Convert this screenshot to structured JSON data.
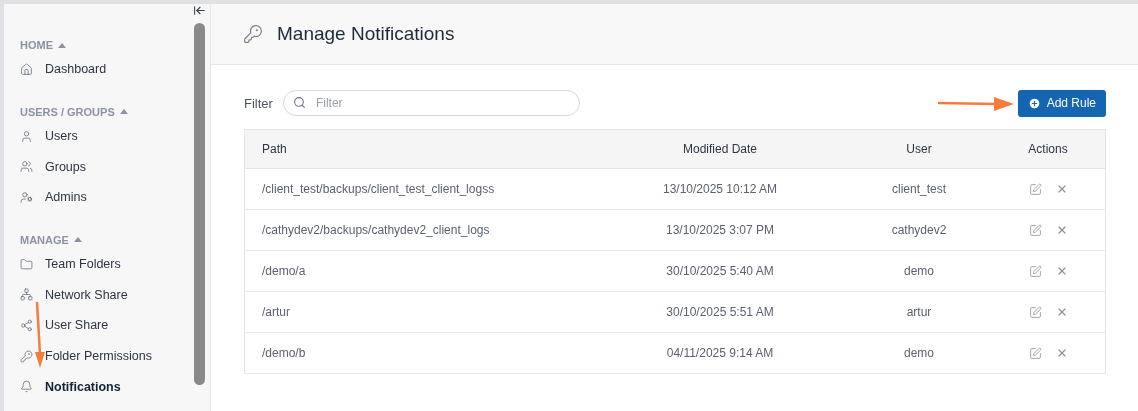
{
  "sidebar": {
    "sections": [
      {
        "title": "HOME",
        "expanded": true,
        "items": [
          {
            "label": "Dashboard",
            "selected": false
          }
        ]
      },
      {
        "title": "USERS / GROUPS",
        "expanded": true,
        "items": [
          {
            "label": "Users",
            "selected": false
          },
          {
            "label": "Groups",
            "selected": false
          },
          {
            "label": "Admins",
            "selected": false
          }
        ]
      },
      {
        "title": "MANAGE",
        "expanded": true,
        "items": [
          {
            "label": "Team Folders",
            "selected": false
          },
          {
            "label": "Network Share",
            "selected": false
          },
          {
            "label": "User Share",
            "selected": false
          },
          {
            "label": "Folder Permissions",
            "selected": false
          },
          {
            "label": "Notifications",
            "selected": true
          }
        ]
      }
    ]
  },
  "page": {
    "title": "Manage Notifications"
  },
  "filter": {
    "label": "Filter",
    "placeholder": "Filter"
  },
  "add_button": "Add Rule",
  "table": {
    "columns": [
      "Path",
      "Modified Date",
      "User",
      "Actions"
    ],
    "rows": [
      {
        "path": "/client_test/backups/client_test_client_logss",
        "modified": "13/10/2025 10:12 AM",
        "user": "client_test"
      },
      {
        "path": "/cathydev2/backups/cathydev2_client_logs",
        "modified": "13/10/2025 3:07 PM",
        "user": "cathydev2"
      },
      {
        "path": "/demo/a",
        "modified": "30/10/2025 5:40 AM",
        "user": "demo"
      },
      {
        "path": "/artur",
        "modified": "30/10/2025 5:51 AM",
        "user": "artur"
      },
      {
        "path": "/demo/b",
        "modified": "04/11/2025 9:14 AM",
        "user": "demo"
      }
    ]
  }
}
